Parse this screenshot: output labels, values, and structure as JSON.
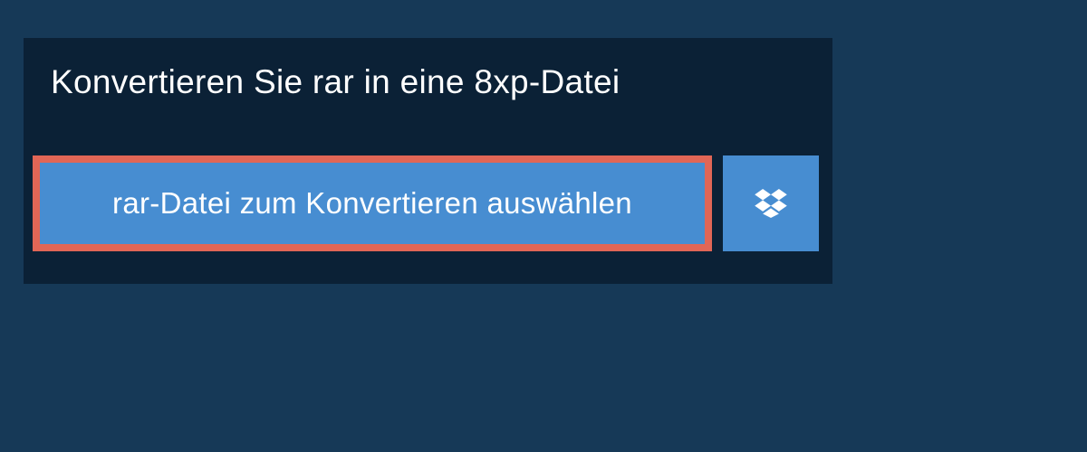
{
  "header": {
    "title": "Konvertieren Sie rar in eine 8xp-Datei"
  },
  "buttons": {
    "select_file_label": "rar-Datei zum Konvertieren auswählen"
  },
  "colors": {
    "page_bg": "#163957",
    "panel_bg": "#0b2136",
    "button_bg": "#478dd1",
    "highlight_border": "#e16656",
    "text": "#ffffff"
  }
}
